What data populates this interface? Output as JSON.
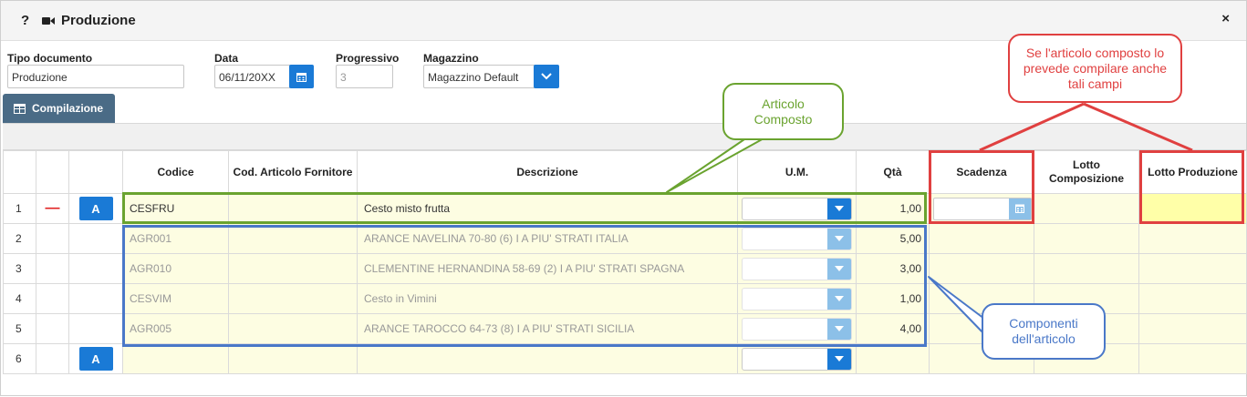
{
  "window": {
    "title": "Produzione",
    "help_icon": "?",
    "close_icon": "×"
  },
  "form": {
    "tipo_label": "Tipo documento",
    "tipo_value": "Produzione",
    "data_label": "Data",
    "data_value": "06/11/20XX",
    "progressivo_label": "Progressivo",
    "progressivo_value": "3",
    "magazzino_label": "Magazzino",
    "magazzino_value": "Magazzino Default"
  },
  "tab": {
    "label": "Compilazione"
  },
  "table": {
    "headers": {
      "codice": "Codice",
      "cod_art_forn": "Cod. Articolo Fornitore",
      "descrizione": "Descrizione",
      "um": "U.M.",
      "qta": "Qtà",
      "scadenza": "Scadenza",
      "lotto_comp": "Lotto Composizione",
      "lotto_prod": "Lotto Produzione"
    },
    "rows": [
      {
        "n": "1",
        "codice": "CESFRU",
        "descrizione": "Cesto misto frutta",
        "qta": "1,00"
      },
      {
        "n": "2",
        "codice": "AGR001",
        "descrizione": "ARANCE NAVELINA 70-80 (6) I A PIU' STRATI     ITALIA",
        "qta": "5,00"
      },
      {
        "n": "3",
        "codice": "AGR010",
        "descrizione": "CLEMENTINE HERNANDINA 58-69 (2) I A PIU' STRATI     SPAGNA",
        "qta": "3,00"
      },
      {
        "n": "4",
        "codice": "CESVIM",
        "descrizione": "Cesto in Vimini",
        "qta": "1,00"
      },
      {
        "n": "5",
        "codice": "AGR005",
        "descrizione": "ARANCE TAROCCO 64-73 (8) I A PIU' STRATI     SICILIA",
        "qta": "4,00"
      },
      {
        "n": "6",
        "codice": "",
        "descrizione": "",
        "qta": ""
      }
    ],
    "a_button": "A",
    "minus": "—"
  },
  "annotations": {
    "articolo": "Articolo Composto",
    "componenti": "Componenti dell'articolo",
    "se": "Se l'articolo composto lo prevede compilare anche tali campi"
  },
  "colors": {
    "green": "#6aa32f",
    "blue": "#4a78c8",
    "red": "#e04040",
    "accent": "#1a7ad6"
  }
}
